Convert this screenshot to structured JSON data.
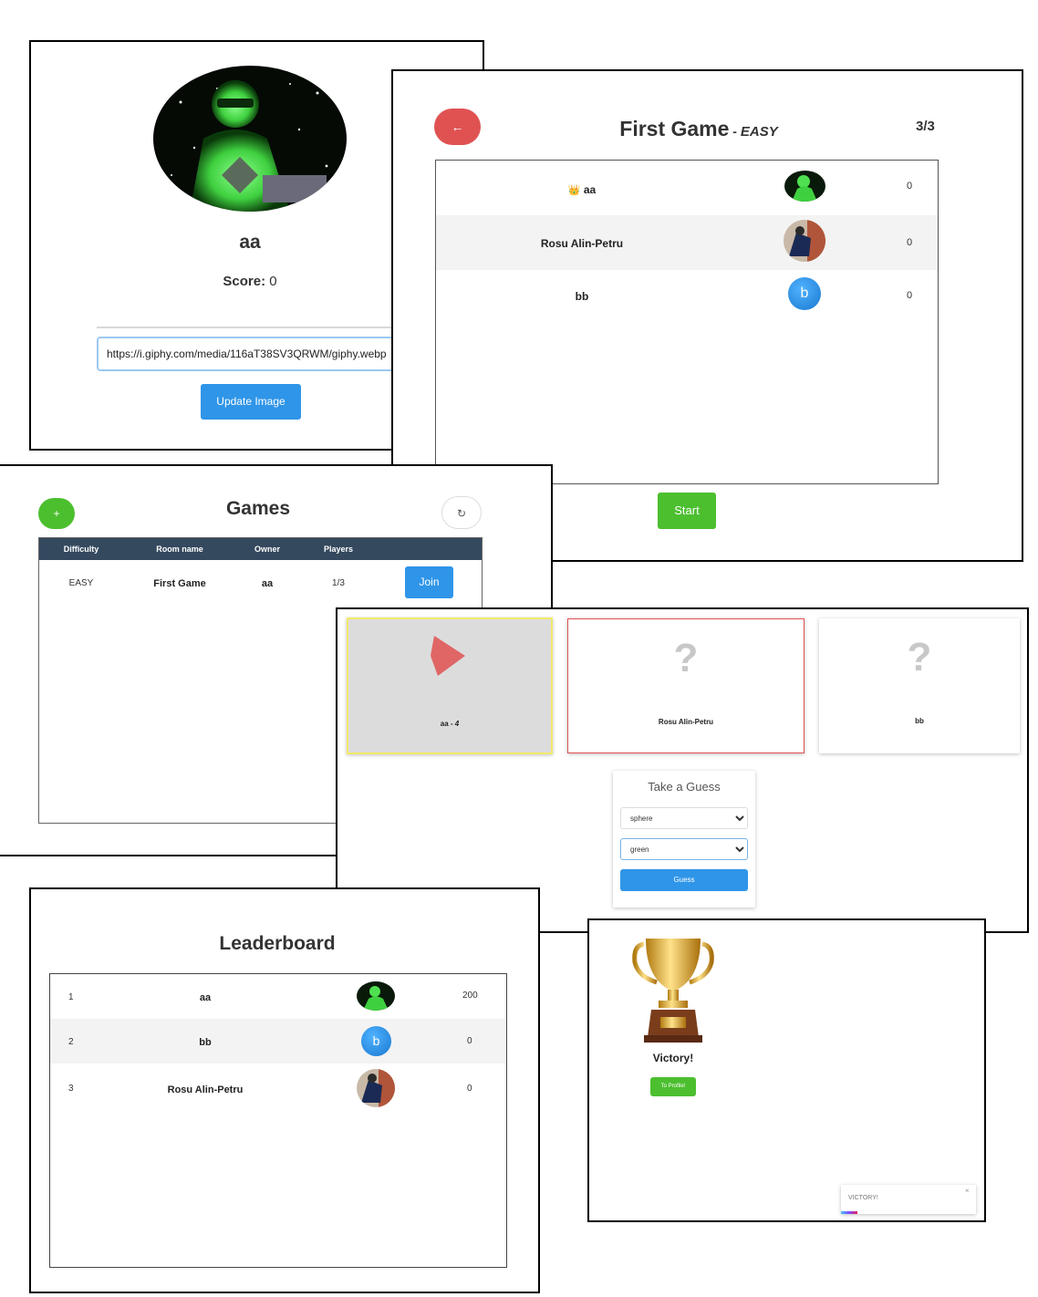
{
  "profile": {
    "username": "aa",
    "score_label": "Score:",
    "score_value": "0",
    "image_url": "https://i.giphy.com/media/116aT38SV3QRWM/giphy.webp",
    "update_button": "Update Image"
  },
  "lobby": {
    "title": "First Game",
    "title_separator": " - ",
    "difficulty": "EASY",
    "player_count": "3/3",
    "crown_icon": "👑",
    "players": [
      {
        "name": "aa",
        "score": "0"
      },
      {
        "name": "Rosu Alin-Petru",
        "score": "0"
      },
      {
        "name": "bb",
        "avatar_letter": "b",
        "score": "0"
      }
    ],
    "start_button": "Start",
    "back_icon": "🢀"
  },
  "games": {
    "title": "Games",
    "add_button": "+",
    "refresh_icon": "↻",
    "columns": [
      "Difficulty",
      "Room name",
      "Owner",
      "Players"
    ],
    "rows": [
      {
        "difficulty": "EASY",
        "room": "First Game",
        "owner": "aa",
        "players": "1/3",
        "action": "Join"
      }
    ]
  },
  "guess": {
    "cards": [
      {
        "label": "aa - ",
        "count": "4"
      },
      {
        "label": "Rosu Alin-Petru",
        "mystery": "?"
      },
      {
        "label": "bb",
        "mystery": "?"
      }
    ],
    "form_title": "Take a Guess",
    "shape_value": "sphere",
    "color_value": "green",
    "guess_button": "Guess"
  },
  "leaderboard": {
    "title": "Leaderboard",
    "rows": [
      {
        "rank": "1",
        "name": "aa",
        "score": "200"
      },
      {
        "rank": "2",
        "name": "bb",
        "avatar_letter": "b",
        "score": "0"
      },
      {
        "rank": "3",
        "name": "Rosu Alin-Petru",
        "score": "0"
      }
    ]
  },
  "victory": {
    "label": "Victory!",
    "button": "To Profile!",
    "toast_text": "VICTORY!",
    "toast_close": "×"
  },
  "colors": {
    "blue": "#2f95e8",
    "green": "#4cbf2f",
    "red": "#e05252",
    "header_dark": "#34495e"
  }
}
